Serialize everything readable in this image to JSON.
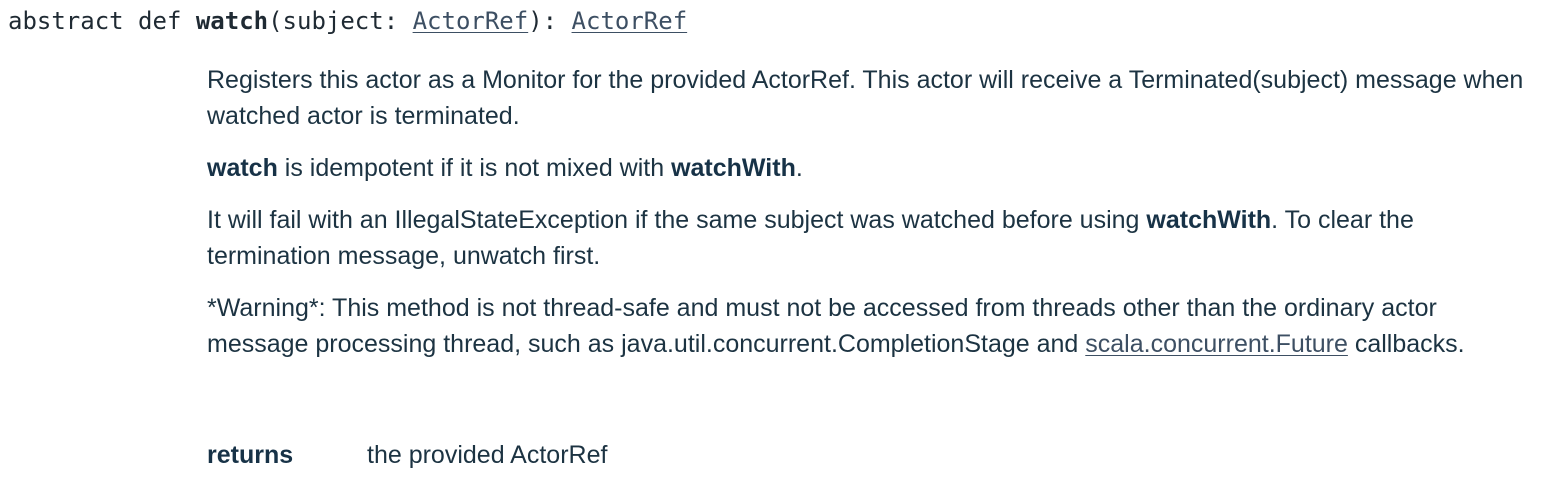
{
  "signature": {
    "modifiers": "abstract def ",
    "name": "watch",
    "open_paren": "(",
    "param_name": "subject: ",
    "param_type": "ActorRef",
    "close": "): ",
    "return_type": "ActorRef"
  },
  "description": {
    "p1": "Registers this actor as a Monitor for the provided ActorRef. This actor will receive a Terminated(subject) message when watched actor is terminated.",
    "p2": {
      "bold1": "watch",
      "text1": " is idempotent if it is not mixed with ",
      "bold2": "watchWith",
      "text2": "."
    },
    "p3": {
      "text1": "It will fail with an IllegalStateException if the same subject was watched before using ",
      "bold1": "watchWith",
      "text2": ". To clear the termination message, unwatch first."
    },
    "p4": {
      "text1": "*Warning*: This method is not thread-safe and must not be accessed from threads other than the ordinary actor message processing thread, such as java.util.concurrent.CompletionStage and ",
      "link": "scala.concurrent.Future",
      "text2": " callbacks."
    }
  },
  "returns": {
    "label": "returns",
    "value": "the provided ActorRef"
  }
}
